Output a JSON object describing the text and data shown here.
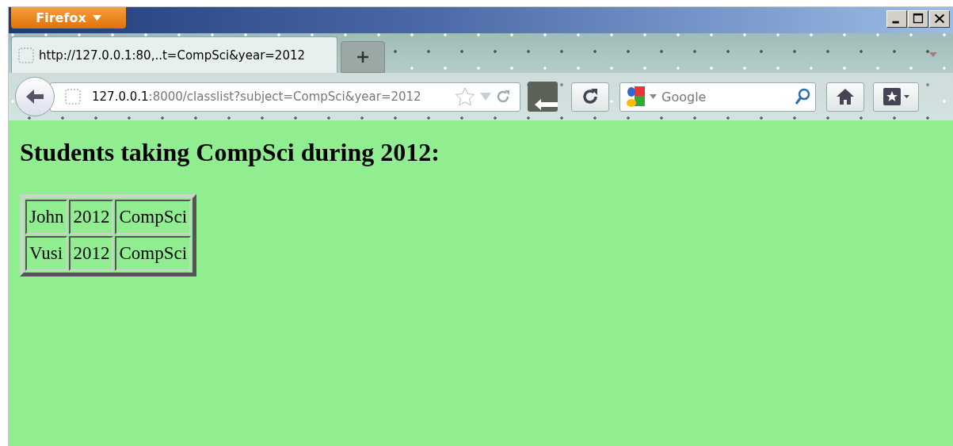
{
  "window": {
    "app_button": "Firefox"
  },
  "tabs": [
    {
      "label": "http://127.0.0.1:80,..t=CompSci&year=2012",
      "selected": true
    }
  ],
  "address_bar": {
    "host": "127.0.0.1",
    "rest": ":8000/classlist?subject=CompSci&year=2012"
  },
  "search": {
    "placeholder": "Google"
  },
  "page": {
    "heading": "Students taking CompSci during 2012:",
    "rows": [
      [
        "John",
        "2012",
        "CompSci"
      ],
      [
        "Vusi",
        "2012",
        "CompSci"
      ]
    ]
  }
}
